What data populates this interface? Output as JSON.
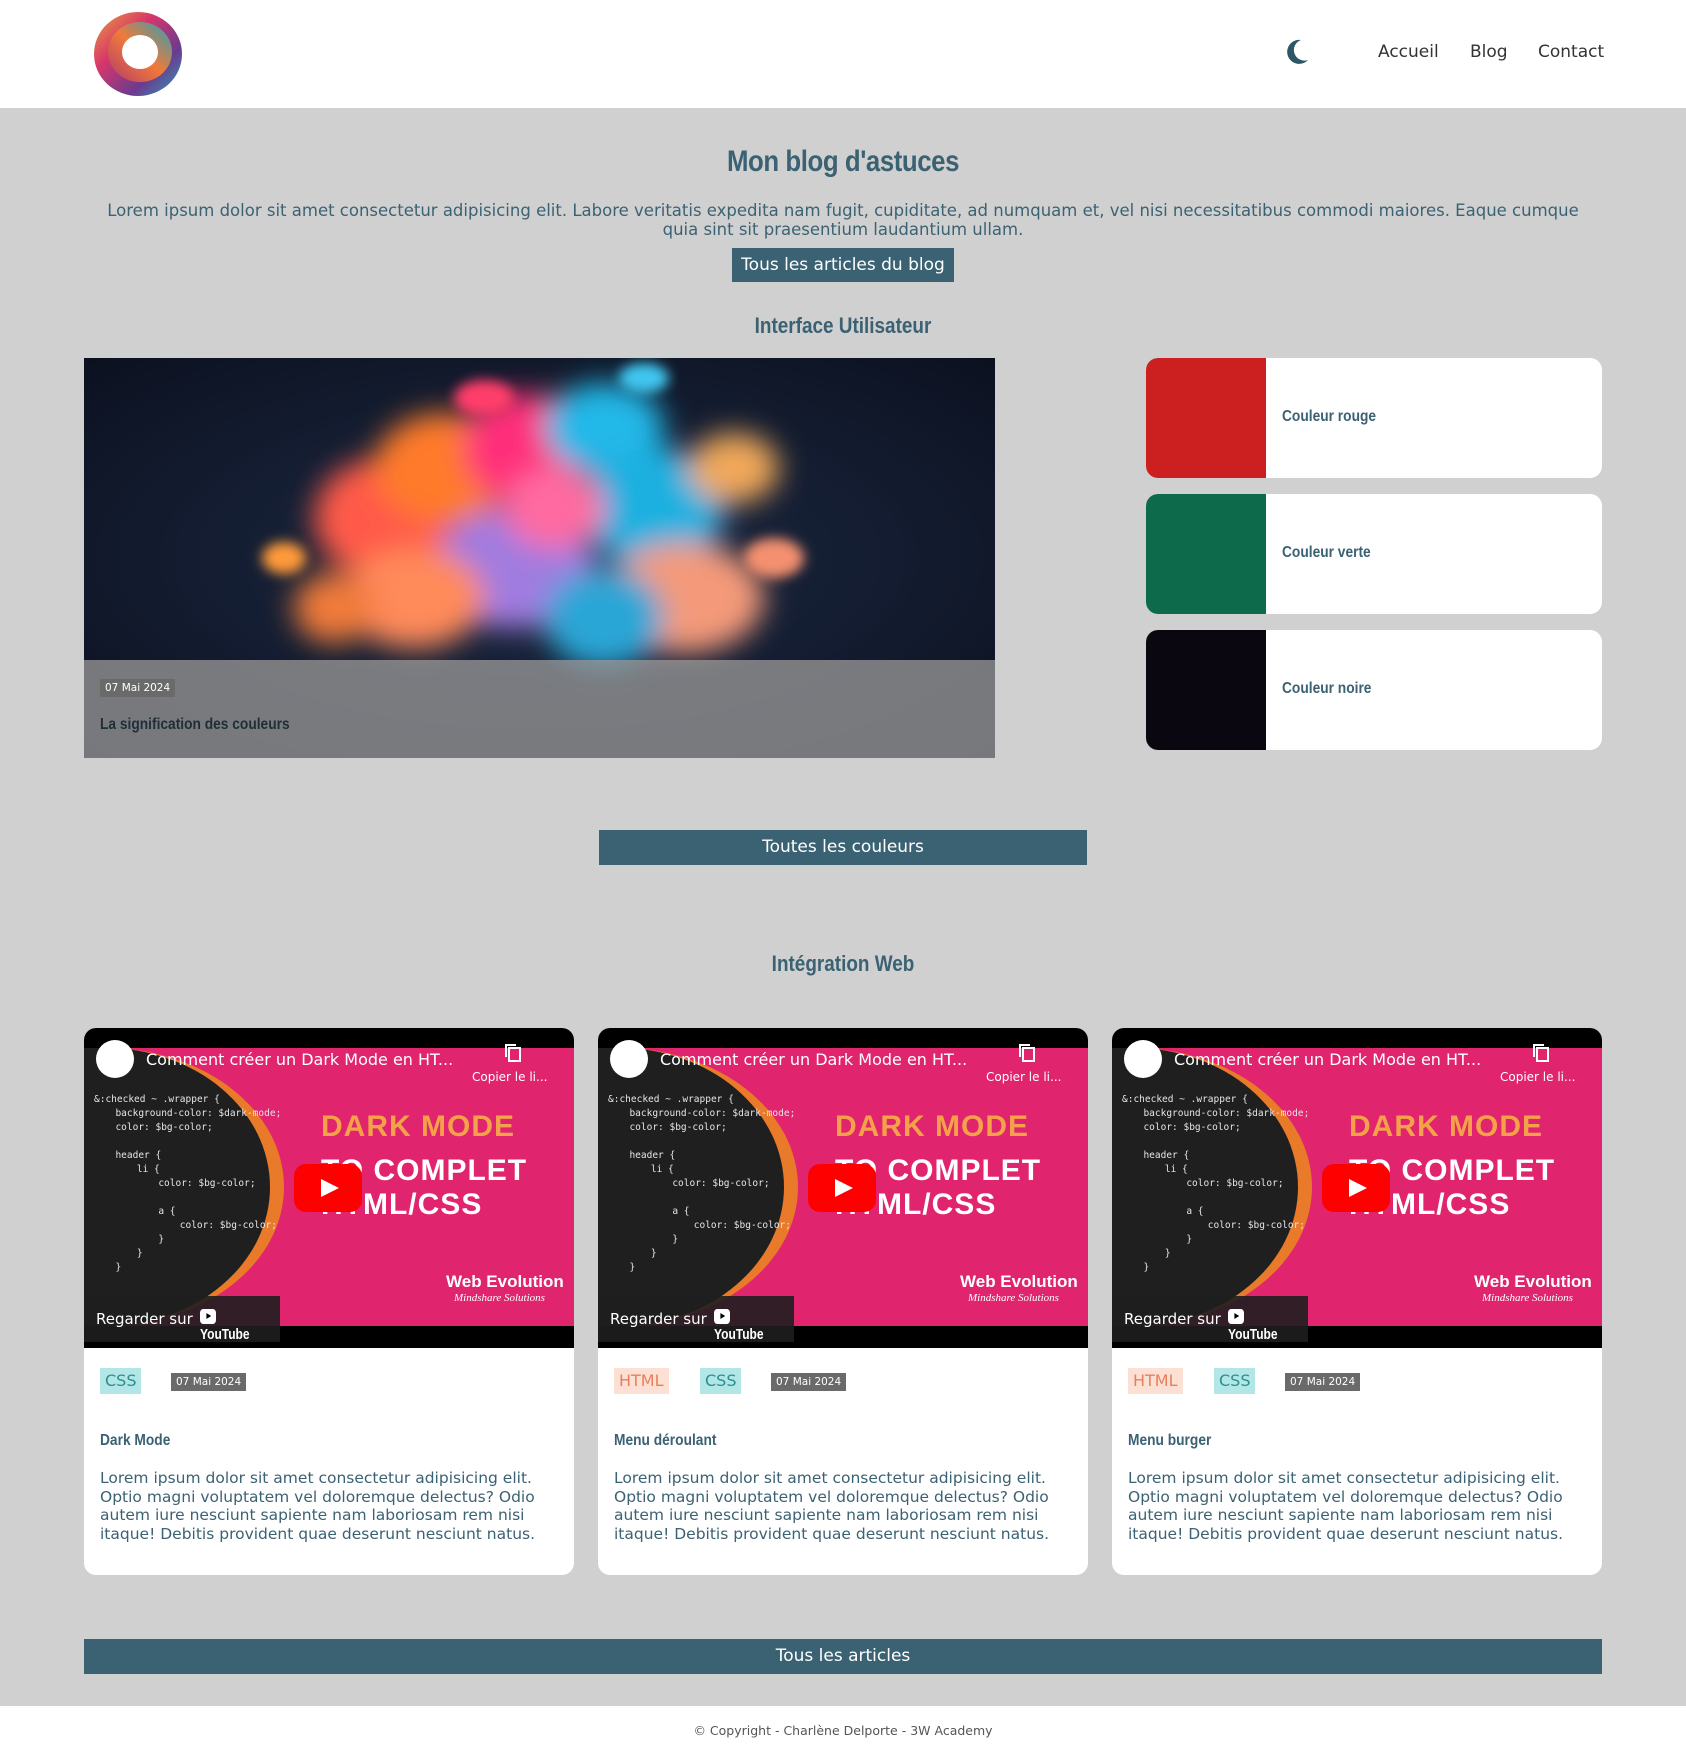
{
  "header": {
    "logo_icon": "swirl-logo-icon",
    "theme_toggle_icon": "moon-icon",
    "nav": [
      {
        "label": "Accueil"
      },
      {
        "label": "Blog"
      },
      {
        "label": "Contact"
      }
    ]
  },
  "hero": {
    "title": "Mon blog d'astuces",
    "text": "Lorem ipsum dolor sit amet consectetur adipisicing elit. Labore veritatis expedita nam fugit, cupiditate, ad numquam et, vel nisi necessitatibus commodi maiores. Eaque cumque quia sint sit praesentium laudantium ullam.",
    "button_label": "Tous les articles du blog"
  },
  "ui_section": {
    "title": "Interface Utilisateur",
    "featured": {
      "date": "07 Mai 2024",
      "title": "La signification des couleurs"
    },
    "colors": [
      {
        "label": "Couleur rouge",
        "color": "#cc1f1f"
      },
      {
        "label": "Couleur verte",
        "color": "#0d6a4b"
      },
      {
        "label": "Couleur noire",
        "color": "#0b0710"
      }
    ],
    "button_label": "Toutes les couleurs"
  },
  "web_section": {
    "title": "Intégration Web",
    "video": {
      "title": "Comment créer un Dark Mode en HT...",
      "copy_label": "Copier le li...",
      "watch_label": "Regarder sur",
      "youtube_label": "YouTube",
      "thumb_title": "DARK MODE",
      "thumb_sub1": "TO COMPLET",
      "thumb_sub2": "HTML/CSS",
      "brand": "Web Evolution",
      "brand_sub": "Mindshare Solutions",
      "code": [
        "&:checked ~ .wrapper {",
        "  background-color: $dark-mode;",
        "  color: $bg-color;",
        "",
        "  header {",
        "    li {",
        "      color: $bg-color;",
        "",
        "      a {",
        "        color: $bg-color;",
        "      }",
        "    }",
        "  }"
      ]
    },
    "articles": [
      {
        "tags": [
          "CSS"
        ],
        "date": "07 Mai 2024",
        "title": "Dark Mode",
        "text": "Lorem ipsum dolor sit amet consectetur adipisicing elit. Optio magni voluptatem vel doloremque delectus? Odio autem iure nesciunt sapiente nam laboriosam rem nisi itaque! Debitis provident quae deserunt nesciunt natus."
      },
      {
        "tags": [
          "HTML",
          "CSS"
        ],
        "date": "07 Mai 2024",
        "title": "Menu déroulant",
        "text": "Lorem ipsum dolor sit amet consectetur adipisicing elit. Optio magni voluptatem vel doloremque delectus? Odio autem iure nesciunt sapiente nam laboriosam rem nisi itaque! Debitis provident quae deserunt nesciunt natus."
      },
      {
        "tags": [
          "HTML",
          "CSS"
        ],
        "date": "07 Mai 2024",
        "title": "Menu burger",
        "text": "Lorem ipsum dolor sit amet consectetur adipisicing elit. Optio magni voluptatem vel doloremque delectus? Odio autem iure nesciunt sapiente nam laboriosam rem nisi itaque! Debitis provident quae deserunt nesciunt natus."
      }
    ],
    "button_label": "Tous les articles"
  },
  "footer": {
    "text": "© Copyright - Charlène Delporte - 3W Academy"
  },
  "colors": {
    "primary": "#3b6273",
    "page_bg": "#d0d0d0",
    "tag_css_bg": "#b3e6e6",
    "tag_html_bg": "#fde0d4"
  }
}
